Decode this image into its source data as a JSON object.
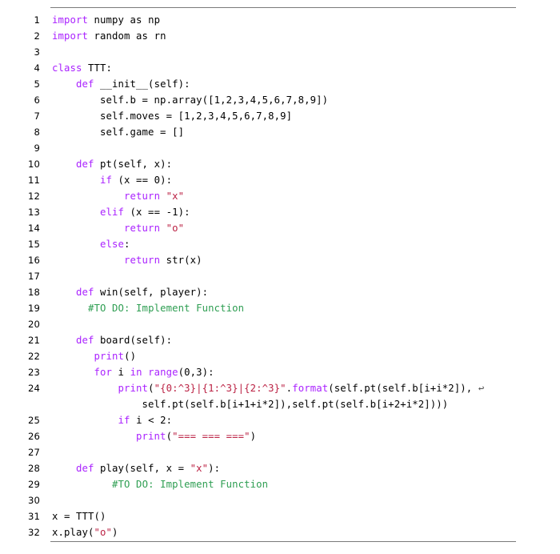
{
  "listing": {
    "language": "python",
    "line_count": 32,
    "colors": {
      "background": "#ffffff",
      "text": "#000000",
      "keyword": "#aa22ff",
      "builtin": "#aa22ff",
      "string": "#bb2244",
      "comment": "#2e9e52",
      "rule": "#7a7a7a"
    },
    "continuation_glyph": "↩",
    "lines": [
      {
        "n": "1",
        "tokens": [
          {
            "t": "import",
            "c": "kw"
          },
          {
            "t": " numpy as np",
            "c": "pl"
          }
        ]
      },
      {
        "n": "2",
        "tokens": [
          {
            "t": "import",
            "c": "kw"
          },
          {
            "t": " random as rn",
            "c": "pl"
          }
        ]
      },
      {
        "n": "3",
        "tokens": []
      },
      {
        "n": "4",
        "tokens": [
          {
            "t": "class",
            "c": "kw"
          },
          {
            "t": " TTT:",
            "c": "pl"
          }
        ]
      },
      {
        "n": "5",
        "tokens": [
          {
            "t": "    ",
            "c": "pl"
          },
          {
            "t": "def",
            "c": "kw"
          },
          {
            "t": " __init__(self):",
            "c": "pl"
          }
        ]
      },
      {
        "n": "6",
        "tokens": [
          {
            "t": "        self.b = np.array([1,2,3,4,5,6,7,8,9])",
            "c": "pl"
          }
        ]
      },
      {
        "n": "7",
        "tokens": [
          {
            "t": "        self.moves = [1,2,3,4,5,6,7,8,9]",
            "c": "pl"
          }
        ]
      },
      {
        "n": "8",
        "tokens": [
          {
            "t": "        self.game = []",
            "c": "pl"
          }
        ]
      },
      {
        "n": "9",
        "tokens": []
      },
      {
        "n": "10",
        "tokens": [
          {
            "t": "    ",
            "c": "pl"
          },
          {
            "t": "def",
            "c": "kw"
          },
          {
            "t": " pt(self, x):",
            "c": "pl"
          }
        ]
      },
      {
        "n": "11",
        "tokens": [
          {
            "t": "        ",
            "c": "pl"
          },
          {
            "t": "if",
            "c": "kw"
          },
          {
            "t": " (x == 0):",
            "c": "pl"
          }
        ]
      },
      {
        "n": "12",
        "tokens": [
          {
            "t": "            ",
            "c": "pl"
          },
          {
            "t": "return",
            "c": "kw"
          },
          {
            "t": " ",
            "c": "pl"
          },
          {
            "t": "\"x\"",
            "c": "st"
          }
        ]
      },
      {
        "n": "13",
        "tokens": [
          {
            "t": "        ",
            "c": "pl"
          },
          {
            "t": "elif",
            "c": "kw"
          },
          {
            "t": " (x == -1):",
            "c": "pl"
          }
        ]
      },
      {
        "n": "14",
        "tokens": [
          {
            "t": "            ",
            "c": "pl"
          },
          {
            "t": "return",
            "c": "kw"
          },
          {
            "t": " ",
            "c": "pl"
          },
          {
            "t": "\"o\"",
            "c": "st"
          }
        ]
      },
      {
        "n": "15",
        "tokens": [
          {
            "t": "        ",
            "c": "pl"
          },
          {
            "t": "else",
            "c": "kw"
          },
          {
            "t": ":",
            "c": "pl"
          }
        ]
      },
      {
        "n": "16",
        "tokens": [
          {
            "t": "            ",
            "c": "pl"
          },
          {
            "t": "return",
            "c": "kw"
          },
          {
            "t": " str(x)",
            "c": "pl"
          }
        ]
      },
      {
        "n": "17",
        "tokens": []
      },
      {
        "n": "18",
        "tokens": [
          {
            "t": "    ",
            "c": "pl"
          },
          {
            "t": "def",
            "c": "kw"
          },
          {
            "t": " win(self, player):",
            "c": "pl"
          }
        ]
      },
      {
        "n": "19",
        "tokens": [
          {
            "t": "      ",
            "c": "pl"
          },
          {
            "t": "#TO DO: Implement Function",
            "c": "cm"
          }
        ]
      },
      {
        "n": "20",
        "tokens": []
      },
      {
        "n": "21",
        "tokens": [
          {
            "t": "    ",
            "c": "pl"
          },
          {
            "t": "def",
            "c": "kw"
          },
          {
            "t": " board(self):",
            "c": "pl"
          }
        ]
      },
      {
        "n": "22",
        "tokens": [
          {
            "t": "       ",
            "c": "pl"
          },
          {
            "t": "print",
            "c": "bi"
          },
          {
            "t": "()",
            "c": "pl"
          }
        ]
      },
      {
        "n": "23",
        "tokens": [
          {
            "t": "       ",
            "c": "pl"
          },
          {
            "t": "for",
            "c": "kw"
          },
          {
            "t": " i ",
            "c": "pl"
          },
          {
            "t": "in",
            "c": "kw"
          },
          {
            "t": " ",
            "c": "pl"
          },
          {
            "t": "range",
            "c": "bi"
          },
          {
            "t": "(0,3):",
            "c": "pl"
          }
        ]
      },
      {
        "n": "24",
        "tokens": [
          {
            "t": "           ",
            "c": "pl"
          },
          {
            "t": "print",
            "c": "bi"
          },
          {
            "t": "(",
            "c": "pl"
          },
          {
            "t": "\"{0:^3}|{1:^3}|{2:^3}\"",
            "c": "st"
          },
          {
            "t": ".",
            "c": "pl"
          },
          {
            "t": "format",
            "c": "bi"
          },
          {
            "t": "(self.pt(self.b[i+i*2]), ",
            "c": "pl"
          },
          {
            "t": "↩",
            "c": "cont"
          }
        ]
      },
      {
        "n": "",
        "tokens": [
          {
            "t": "               self.pt(self.b[i+1+i*2]),self.pt(self.b[i+2+i*2])))",
            "c": "pl"
          }
        ]
      },
      {
        "n": "25",
        "tokens": [
          {
            "t": "           ",
            "c": "pl"
          },
          {
            "t": "if",
            "c": "kw"
          },
          {
            "t": " i < 2:",
            "c": "pl"
          }
        ]
      },
      {
        "n": "26",
        "tokens": [
          {
            "t": "              ",
            "c": "pl"
          },
          {
            "t": "print",
            "c": "bi"
          },
          {
            "t": "(",
            "c": "pl"
          },
          {
            "t": "\"=== === ===\"",
            "c": "st"
          },
          {
            "t": ")",
            "c": "pl"
          }
        ]
      },
      {
        "n": "27",
        "tokens": []
      },
      {
        "n": "28",
        "tokens": [
          {
            "t": "    ",
            "c": "pl"
          },
          {
            "t": "def",
            "c": "kw"
          },
          {
            "t": " play(self, x = ",
            "c": "pl"
          },
          {
            "t": "\"x\"",
            "c": "st"
          },
          {
            "t": "):",
            "c": "pl"
          }
        ]
      },
      {
        "n": "29",
        "tokens": [
          {
            "t": "          ",
            "c": "pl"
          },
          {
            "t": "#TO DO: Implement Function",
            "c": "cm"
          }
        ]
      },
      {
        "n": "30",
        "tokens": []
      },
      {
        "n": "31",
        "tokens": [
          {
            "t": "x = TTT()",
            "c": "pl"
          }
        ]
      },
      {
        "n": "32",
        "tokens": [
          {
            "t": "x.play(",
            "c": "pl"
          },
          {
            "t": "\"o\"",
            "c": "st"
          },
          {
            "t": ")",
            "c": "pl"
          }
        ]
      }
    ]
  }
}
